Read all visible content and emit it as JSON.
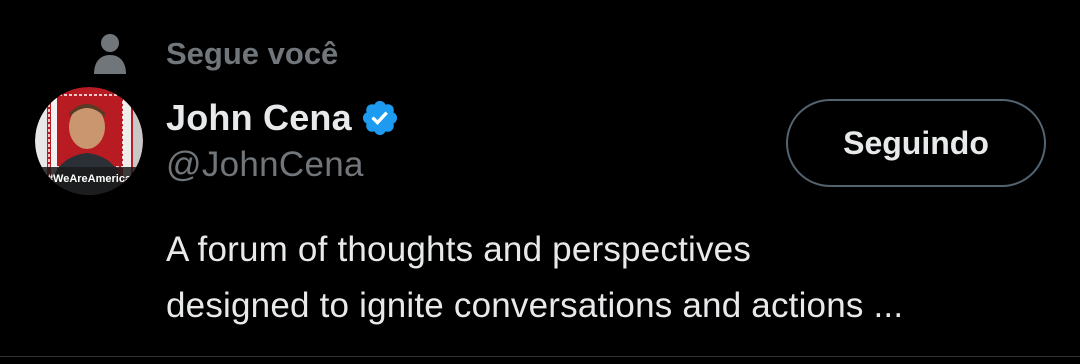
{
  "context": {
    "label": "Segue você",
    "icon": "person-icon"
  },
  "user": {
    "display_name": "John Cena",
    "handle": "@JohnCena",
    "verified_icon": "verified-badge-icon",
    "avatar_caption": "#WeAreAmerica",
    "bio_lines": [
      "A forum of thoughts and perspectives",
      "designed to ignite conversations and actions ..."
    ]
  },
  "follow_button": {
    "label": "Seguindo"
  },
  "colors": {
    "background": "#000000",
    "primary_text": "#e7e9ea",
    "secondary_text": "#71767b",
    "verified_blue": "#1d9bf0",
    "button_border": "#536471"
  }
}
